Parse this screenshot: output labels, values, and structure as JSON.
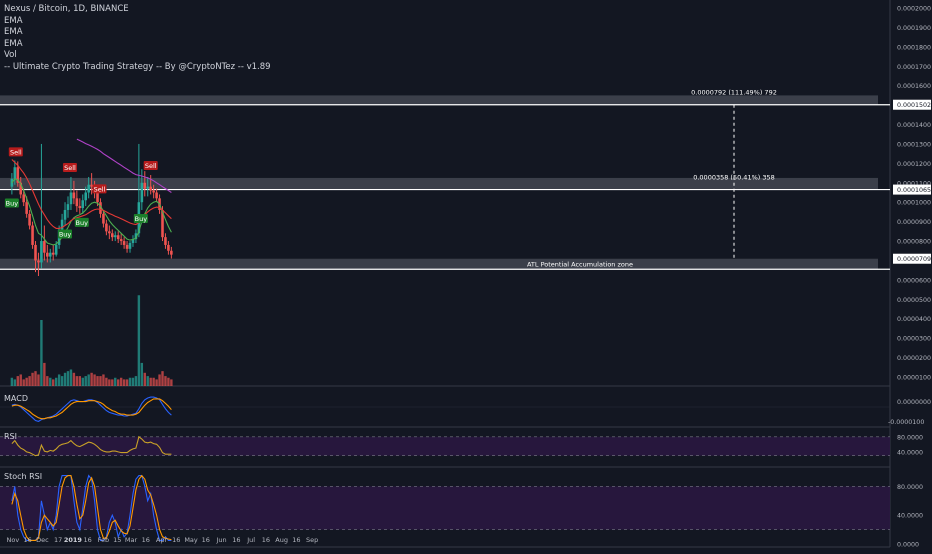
{
  "legend": {
    "symbol_line": "Nexus / Bitcoin, 1D, BINANCE",
    "studies": [
      "EMA",
      "EMA",
      "EMA",
      "Vol",
      "-- Ultimate Crypto Trading Strategy -- By @CryptoNTez -- v1.89"
    ]
  },
  "panes": {
    "macd_label": "MACD",
    "rsi_label": "RSI",
    "stoch_label": "Stoch RSI"
  },
  "colors": {
    "background": "#131722",
    "up": "#26a69a",
    "down": "#ef5350",
    "ema_fast": "#4caf50",
    "ema_mid": "#e53935",
    "ema_slow": "#b042c8",
    "macd": "#2962ff",
    "signal": "#ff9800",
    "rsi": "#c9a227",
    "stoch_k": "#2962ff",
    "stoch_d": "#ff9800",
    "band": "#2a1740"
  },
  "chart_data": {
    "type": "candlestick",
    "y_ticks": [
      "0.0002000",
      "0.0001900",
      "0.0001800",
      "0.0001700",
      "0.0001600",
      "0.0001502",
      "0.0001400",
      "0.0001300",
      "0.0001200",
      "0.0001100",
      "0.0001065",
      "0.0001000",
      "0.0000900",
      "0.0000800",
      "0.0000709",
      "0.0000600",
      "0.0000500",
      "0.0000400",
      "0.0000300",
      "0.0000200",
      "0.0000100"
    ],
    "highlighted_ticks": [
      "0.0001502",
      "0.0001065",
      "0.0000709"
    ],
    "x_ticks": [
      "Nov",
      "16",
      "Dec",
      "17",
      "2019",
      "16",
      "Feb",
      "15",
      "Mar",
      "16",
      "Apr",
      "16",
      "May",
      "16",
      "Jun",
      "16",
      "Jul",
      "16",
      "Aug",
      "16",
      "Sep"
    ],
    "ylim": [
      5e-05,
      0.0002
    ],
    "zones": [
      {
        "from": 0.0001502,
        "to": 0.000155,
        "label": ""
      },
      {
        "from": 0.0001065,
        "to": 0.0001125,
        "label": ""
      },
      {
        "from": 6.55e-05,
        "to": 7.09e-05,
        "label": "ATL Potential Accumulation zone"
      }
    ],
    "measurements": [
      {
        "label": "0.0000792 (111.49%) 792",
        "level": 0.0001502
      },
      {
        "label": "0.0000358 (50.41%) 358",
        "level": 0.0001065
      }
    ],
    "signals": [
      {
        "type": "Sell",
        "date": "2018-11-04"
      },
      {
        "type": "Buy",
        "date": "2018-10-31"
      },
      {
        "type": "Sell",
        "date": "2018-12-29"
      },
      {
        "type": "Buy",
        "date": "2018-12-24"
      },
      {
        "type": "Buy",
        "date": "2019-01-10"
      },
      {
        "type": "Sell",
        "date": "2019-01-28"
      },
      {
        "type": "Sell",
        "date": "2019-03-21"
      },
      {
        "type": "Buy",
        "date": "2019-03-11"
      }
    ],
    "macd_tick": "0.0000000",
    "macd_tick_2": "-0.0000100",
    "rsi_ticks": [
      "80.0000",
      "40.0000"
    ],
    "stoch_ticks": [
      "80.0000",
      "40.0000",
      "0.0000"
    ],
    "candles": [
      {
        "date": "2018-10-31",
        "o": 0.000108,
        "h": 0.000115,
        "l": 0.000104,
        "c": 0.000112
      },
      {
        "date": "2018-11-03",
        "o": 0.000112,
        "h": 0.0001215,
        "l": 0.000109,
        "c": 0.000118
      },
      {
        "date": "2018-11-06",
        "o": 0.000118,
        "h": 0.000121,
        "l": 0.000108,
        "c": 0.00011
      },
      {
        "date": "2018-11-09",
        "o": 0.00011,
        "h": 0.000113,
        "l": 0.000102,
        "c": 0.000104
      },
      {
        "date": "2018-11-12",
        "o": 0.000104,
        "h": 0.000107,
        "l": 9.8e-05,
        "c": 0.0001
      },
      {
        "date": "2018-11-15",
        "o": 0.0001,
        "h": 0.000103,
        "l": 9.2e-05,
        "c": 9.4e-05
      },
      {
        "date": "2018-11-18",
        "o": 9.4e-05,
        "h": 9.6e-05,
        "l": 8.6e-05,
        "c": 8.8e-05
      },
      {
        "date": "2018-11-21",
        "o": 8.8e-05,
        "h": 9e-05,
        "l": 7.6e-05,
        "c": 7.8e-05
      },
      {
        "date": "2018-11-24",
        "o": 7.8e-05,
        "h": 8e-05,
        "l": 6.4e-05,
        "c": 7e-05
      },
      {
        "date": "2018-11-27",
        "o": 7e-05,
        "h": 7.4e-05,
        "l": 6.2e-05,
        "c": 6.9e-05
      },
      {
        "date": "2018-11-30",
        "o": 6.9e-05,
        "h": 0.00013,
        "l": 6.6e-05,
        "c": 8e-05
      },
      {
        "date": "2018-12-03",
        "o": 8e-05,
        "h": 8.8e-05,
        "l": 7e-05,
        "c": 7.4e-05
      },
      {
        "date": "2018-12-06",
        "o": 7.4e-05,
        "h": 7.8e-05,
        "l": 6.9e-05,
        "c": 7.2e-05
      },
      {
        "date": "2018-12-09",
        "o": 7.2e-05,
        "h": 7.6e-05,
        "l": 6.9e-05,
        "c": 7.4e-05
      },
      {
        "date": "2018-12-12",
        "o": 7.4e-05,
        "h": 7.8e-05,
        "l": 7e-05,
        "c": 7.3e-05
      },
      {
        "date": "2018-12-15",
        "o": 7.3e-05,
        "h": 8e-05,
        "l": 7.2e-05,
        "c": 7.8e-05
      },
      {
        "date": "2018-12-18",
        "o": 7.8e-05,
        "h": 8.8e-05,
        "l": 7.6e-05,
        "c": 8.6e-05
      },
      {
        "date": "2018-12-21",
        "o": 8.6e-05,
        "h": 9.4e-05,
        "l": 8.3e-05,
        "c": 9.1e-05
      },
      {
        "date": "2018-12-24",
        "o": 9.1e-05,
        "h": 0.0001,
        "l": 8.8e-05,
        "c": 9.6e-05
      },
      {
        "date": "2018-12-27",
        "o": 9.6e-05,
        "h": 0.000103,
        "l": 9.2e-05,
        "c": 9.9e-05
      },
      {
        "date": "2018-12-30",
        "o": 9.9e-05,
        "h": 0.000113,
        "l": 9.6e-05,
        "c": 0.000105
      },
      {
        "date": "2019-01-02",
        "o": 0.000105,
        "h": 0.000111,
        "l": 9.9e-05,
        "c": 0.000102
      },
      {
        "date": "2019-01-05",
        "o": 0.000102,
        "h": 0.000106,
        "l": 9.5e-05,
        "c": 9.8e-05
      },
      {
        "date": "2019-01-08",
        "o": 9.8e-05,
        "h": 0.000102,
        "l": 9.4e-05,
        "c": 9.7e-05
      },
      {
        "date": "2019-01-11",
        "o": 9.7e-05,
        "h": 0.000104,
        "l": 9.4e-05,
        "c": 0.000101
      },
      {
        "date": "2019-01-14",
        "o": 0.000101,
        "h": 0.000108,
        "l": 9.8e-05,
        "c": 0.000105
      },
      {
        "date": "2019-01-17",
        "o": 0.000105,
        "h": 0.000113,
        "l": 0.000102,
        "c": 0.000109
      },
      {
        "date": "2019-01-20",
        "o": 0.000109,
        "h": 0.000115,
        "l": 0.000104,
        "c": 0.000108
      },
      {
        "date": "2019-01-23",
        "o": 0.000108,
        "h": 0.000111,
        "l": 0.000102,
        "c": 0.000105
      },
      {
        "date": "2019-01-26",
        "o": 0.000105,
        "h": 0.000108,
        "l": 9.8e-05,
        "c": 0.0001
      },
      {
        "date": "2019-01-29",
        "o": 0.0001,
        "h": 0.000102,
        "l": 9.2e-05,
        "c": 9.4e-05
      },
      {
        "date": "2019-02-01",
        "o": 9.4e-05,
        "h": 9.6e-05,
        "l": 8.7e-05,
        "c": 8.9e-05
      },
      {
        "date": "2019-02-04",
        "o": 8.9e-05,
        "h": 9.1e-05,
        "l": 8.3e-05,
        "c": 8.5e-05
      },
      {
        "date": "2019-02-07",
        "o": 8.5e-05,
        "h": 8.8e-05,
        "l": 8.1e-05,
        "c": 8.4e-05
      },
      {
        "date": "2019-02-10",
        "o": 8.4e-05,
        "h": 8.6e-05,
        "l": 8e-05,
        "c": 8.2e-05
      },
      {
        "date": "2019-02-13",
        "o": 8.2e-05,
        "h": 8.5e-05,
        "l": 8e-05,
        "c": 8.3e-05
      },
      {
        "date": "2019-02-16",
        "o": 8.3e-05,
        "h": 8.5e-05,
        "l": 7.9e-05,
        "c": 8.1e-05
      },
      {
        "date": "2019-02-19",
        "o": 8.1e-05,
        "h": 8.4e-05,
        "l": 7.8e-05,
        "c": 8e-05
      },
      {
        "date": "2019-02-22",
        "o": 8e-05,
        "h": 8.2e-05,
        "l": 7.6e-05,
        "c": 7.8e-05
      },
      {
        "date": "2019-02-25",
        "o": 7.8e-05,
        "h": 8e-05,
        "l": 7.4e-05,
        "c": 7.6e-05
      },
      {
        "date": "2019-02-28",
        "o": 7.6e-05,
        "h": 8e-05,
        "l": 7.4e-05,
        "c": 7.9e-05
      },
      {
        "date": "2019-03-03",
        "o": 7.9e-05,
        "h": 8.3e-05,
        "l": 7.7e-05,
        "c": 8.1e-05
      },
      {
        "date": "2019-03-06",
        "o": 8.1e-05,
        "h": 8.6e-05,
        "l": 7.9e-05,
        "c": 8.4e-05
      },
      {
        "date": "2019-03-09",
        "o": 8.4e-05,
        "h": 0.00013,
        "l": 8.2e-05,
        "c": 0.0001
      },
      {
        "date": "2019-03-12",
        "o": 0.0001,
        "h": 0.000117,
        "l": 9.6e-05,
        "c": 0.00011
      },
      {
        "date": "2019-03-15",
        "o": 0.00011,
        "h": 0.000116,
        "l": 0.000103,
        "c": 0.000107
      },
      {
        "date": "2019-03-18",
        "o": 0.000107,
        "h": 0.000113,
        "l": 0.000103,
        "c": 0.000108
      },
      {
        "date": "2019-03-21",
        "o": 0.000108,
        "h": 0.000114,
        "l": 0.000104,
        "c": 0.000106
      },
      {
        "date": "2019-03-24",
        "o": 0.000106,
        "h": 0.000109,
        "l": 0.000102,
        "c": 0.000105
      },
      {
        "date": "2019-03-27",
        "o": 0.000105,
        "h": 0.000107,
        "l": 0.0001,
        "c": 0.000102
      },
      {
        "date": "2019-03-30",
        "o": 0.000102,
        "h": 0.000104,
        "l": 9.4e-05,
        "c": 9.6e-05
      },
      {
        "date": "2019-04-02",
        "o": 9.6e-05,
        "h": 9.8e-05,
        "l": 8e-05,
        "c": 8.2e-05
      },
      {
        "date": "2019-04-05",
        "o": 8.2e-05,
        "h": 8.4e-05,
        "l": 7.6e-05,
        "c": 7.8e-05
      },
      {
        "date": "2019-04-08",
        "o": 7.8e-05,
        "h": 8e-05,
        "l": 7.3e-05,
        "c": 7.5e-05
      },
      {
        "date": "2019-04-11",
        "o": 7.5e-05,
        "h": 7.7e-05,
        "l": 7.1e-05,
        "c": 7.3e-05
      }
    ],
    "volume": [
      5,
      4,
      6,
      7,
      4,
      5,
      6,
      8,
      9,
      7,
      40,
      14,
      6,
      5,
      4,
      5,
      7,
      6,
      8,
      9,
      10,
      8,
      6,
      6,
      5,
      6,
      7,
      8,
      7,
      6,
      6,
      7,
      5,
      4,
      4,
      5,
      4,
      5,
      4,
      4,
      5,
      5,
      6,
      55,
      14,
      8,
      6,
      5,
      5,
      4,
      7,
      9,
      6,
      5,
      4
    ],
    "ema_fast": [
      0.00011,
      0.000112,
      0.0001115,
      0.0001095,
      0.000106,
      0.000102,
      9.8e-05,
      9.3e-05,
      8.8e-05,
      8.4e-05,
      8.3e-05,
      8.1e-05,
      7.9e-05,
      7.85e-05,
      7.8e-05,
      7.85e-05,
      8e-05,
      8.2e-05,
      8.45e-05,
      8.7e-05,
      9e-05,
      9.2e-05,
      9.3e-05,
      9.35e-05,
      9.45e-05,
      9.6e-05,
      9.8e-05,
      9.95e-05,
      0.0001,
      9.95e-05,
      9.8e-05,
      9.55e-05,
      9.3e-05,
      9.05e-05,
      8.85e-05,
      8.7e-05,
      8.55e-05,
      8.4e-05,
      8.25e-05,
      8.1e-05,
      8.05e-05,
      8.08e-05,
      8.15e-05,
      8.5e-05,
      9e-05,
      9.4e-05,
      9.7e-05,
      9.9e-05,
      0.0001,
      0.0001005,
      9.9e-05,
      9.5e-05,
      9.1e-05,
      8.75e-05,
      8.45e-05
    ],
    "ema_mid": [
      0.000122,
      0.0001205,
      0.000119,
      0.000117,
      0.000115,
      0.0001125,
      0.0001095,
      0.000106,
      0.0001025,
      9.9e-05,
      9.6e-05,
      9.35e-05,
      9.1e-05,
      8.9e-05,
      8.75e-05,
      8.65e-05,
      8.65e-05,
      8.7e-05,
      8.8e-05,
      8.9e-05,
      9.05e-05,
      9.15e-05,
      9.2e-05,
      9.25e-05,
      9.3e-05,
      9.35e-05,
      9.45e-05,
      9.55e-05,
      9.62e-05,
      9.65e-05,
      9.63e-05,
      9.58e-05,
      9.5e-05,
      9.42e-05,
      9.35e-05,
      9.28e-05,
      9.22e-05,
      9.15e-05,
      9.08e-05,
      9e-05,
      8.93e-05,
      8.88e-05,
      8.85e-05,
      8.95e-05,
      9.15e-05,
      9.35e-05,
      9.5e-05,
      9.62e-05,
      9.7e-05,
      9.75e-05,
      9.72e-05,
      9.6e-05,
      9.45e-05,
      9.3e-05,
      9.15e-05
    ],
    "ema_slow": [
      null,
      null,
      null,
      null,
      null,
      null,
      null,
      null,
      null,
      null,
      null,
      null,
      null,
      null,
      null,
      null,
      null,
      null,
      null,
      null,
      null,
      null,
      0.0001325,
      0.0001318,
      0.000131,
      0.0001302,
      0.0001295,
      0.0001288,
      0.000128,
      0.0001272,
      0.0001262,
      0.000125,
      0.000124,
      0.000123,
      0.000122,
      0.000121,
      0.00012,
      0.000119,
      0.000118,
      0.000117,
      0.000116,
      0.000115,
      0.0001142,
      0.0001138,
      0.0001135,
      0.000113,
      0.0001125,
      0.0001118,
      0.000111,
      0.00011,
      0.000109,
      0.000108,
      0.000107,
      0.000106,
      0.000105
    ],
    "macd": [
      0.2,
      0.3,
      0.2,
      0.0,
      -0.3,
      -0.6,
      -0.9,
      -1.2,
      -1.5,
      -1.6,
      -1.4,
      -1.3,
      -1.2,
      -1.1,
      -1.0,
      -0.8,
      -0.5,
      -0.2,
      0.1,
      0.4,
      0.7,
      0.8,
      0.7,
      0.6,
      0.6,
      0.7,
      0.8,
      0.8,
      0.7,
      0.5,
      0.2,
      -0.1,
      -0.4,
      -0.6,
      -0.7,
      -0.8,
      -0.9,
      -0.9,
      -1.0,
      -1.0,
      -0.9,
      -0.8,
      -0.7,
      -0.2,
      0.4,
      0.8,
      1.0,
      1.1,
      1.1,
      1.0,
      0.8,
      0.3,
      -0.2,
      -0.6,
      -0.9
    ],
    "signal": [
      0.1,
      0.2,
      0.2,
      0.1,
      -0.1,
      -0.3,
      -0.5,
      -0.8,
      -1.0,
      -1.2,
      -1.3,
      -1.3,
      -1.2,
      -1.2,
      -1.1,
      -1.0,
      -0.8,
      -0.6,
      -0.3,
      0.0,
      0.3,
      0.5,
      0.6,
      0.6,
      0.6,
      0.6,
      0.7,
      0.7,
      0.7,
      0.6,
      0.5,
      0.3,
      0.0,
      -0.2,
      -0.4,
      -0.5,
      -0.7,
      -0.8,
      -0.8,
      -0.9,
      -0.9,
      -0.9,
      -0.8,
      -0.6,
      -0.2,
      0.2,
      0.5,
      0.7,
      0.9,
      0.9,
      0.9,
      0.7,
      0.4,
      0.1,
      -0.3
    ],
    "rsi": [
      62,
      70,
      58,
      50,
      46,
      40,
      38,
      34,
      30,
      32,
      58,
      42,
      40,
      44,
      42,
      48,
      56,
      60,
      62,
      64,
      70,
      62,
      56,
      54,
      58,
      62,
      66,
      64,
      60,
      54,
      46,
      42,
      40,
      40,
      42,
      42,
      40,
      38,
      38,
      38,
      44,
      48,
      50,
      80,
      74,
      66,
      64,
      66,
      62,
      60,
      52,
      38,
      34,
      34,
      34
    ],
    "stoch_k": [
      60,
      80,
      40,
      20,
      10,
      5,
      5,
      5,
      5,
      10,
      60,
      40,
      20,
      30,
      20,
      40,
      80,
      95,
      95,
      95,
      95,
      60,
      30,
      20,
      50,
      80,
      95,
      90,
      60,
      20,
      5,
      5,
      10,
      30,
      40,
      30,
      10,
      20,
      10,
      15,
      40,
      70,
      90,
      95,
      95,
      80,
      60,
      70,
      40,
      20,
      5,
      5,
      10,
      5,
      5
    ],
    "stoch_d": [
      55,
      70,
      60,
      40,
      20,
      10,
      5,
      5,
      5,
      8,
      30,
      40,
      35,
      30,
      25,
      30,
      55,
      80,
      92,
      95,
      95,
      80,
      55,
      35,
      40,
      60,
      85,
      92,
      80,
      50,
      20,
      8,
      8,
      18,
      30,
      33,
      25,
      18,
      15,
      14,
      25,
      50,
      75,
      90,
      95,
      90,
      75,
      68,
      55,
      40,
      20,
      10,
      8,
      7,
      6
    ]
  }
}
